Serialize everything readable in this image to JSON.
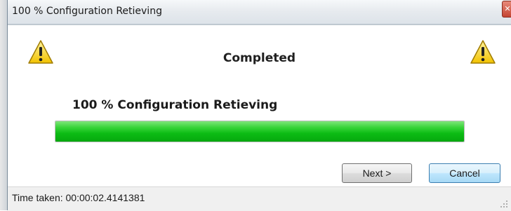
{
  "window": {
    "title": "100 % Configuration Retieving",
    "close_icon": "close-icon"
  },
  "content": {
    "heading": "Completed",
    "warning_icon": "warning-triangle-icon",
    "progress_label": "100 % Configuration Retieving",
    "progress_fraction": 1.0,
    "progress_color": "#0cbc14"
  },
  "buttons": {
    "next_label": "Next >",
    "cancel_label": "Cancel"
  },
  "status": {
    "time_taken": "Time taken: 00:00:02.4141381"
  }
}
